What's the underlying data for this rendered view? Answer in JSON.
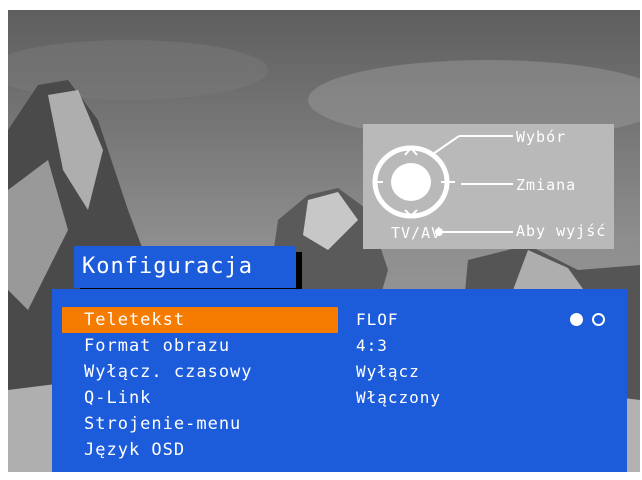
{
  "hint": {
    "select_label": "Wybór",
    "change_label": "Zmiana",
    "tvav_label": "TV/AV",
    "exit_label": "Aby wyjść"
  },
  "menu": {
    "title": "Konfiguracja",
    "items": [
      {
        "label": "Teletekst",
        "value": "FLOF",
        "selected": true
      },
      {
        "label": "Format obrazu",
        "value": "4:3"
      },
      {
        "label": "Wyłącz. czasowy",
        "value": "Wyłącz"
      },
      {
        "label": "Q-Link",
        "value": "Włączony"
      },
      {
        "label": "Strojenie-menu",
        "value": ""
      },
      {
        "label": "Język OSD",
        "value": ""
      }
    ]
  },
  "colors": {
    "menu_background": "#1c5bd9",
    "selection_highlight": "#f57c00",
    "hint_panel": "#b9b9b9"
  }
}
